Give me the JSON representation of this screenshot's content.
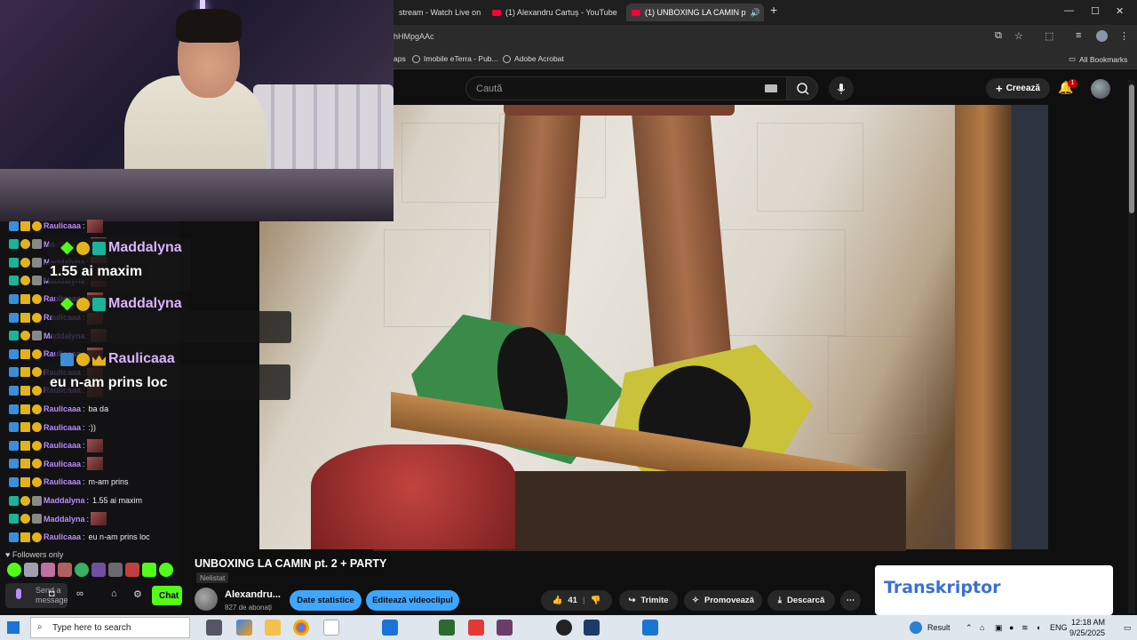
{
  "browser": {
    "tabs": [
      {
        "title": "stream - Watch Live on",
        "active": false
      },
      {
        "title": "(1) Alexandru Cartuș - YouTube",
        "active": false
      },
      {
        "title": "(1) UNBOXING LA CAMIN p",
        "active": true
      }
    ],
    "url_fragment": "hHMpgAAc",
    "bookmarks": [
      "aps",
      "Imobile eTerra - Pub...",
      "Adobe Acrobat"
    ],
    "all_bookmarks": "All Bookmarks"
  },
  "youtube": {
    "search_placeholder": "Caută",
    "create_label": "Creează",
    "notification_count": "1",
    "video_title": "UNBOXING LA CAMIN pt. 2 + PARTY",
    "visibility": "Nelistat",
    "channel_name": "Alexandru...",
    "subscribers": "827 de abonați",
    "buttons": {
      "stats": "Date statistice",
      "edit": "Editează videoclipul",
      "likes": "41",
      "share": "Trimite",
      "promote": "Promovează",
      "download": "Descarcă"
    }
  },
  "chat": {
    "lines": [
      {
        "user": "Raulicaaa",
        "msg": ""
      },
      {
        "user": "Maddalyna",
        "msg": ""
      },
      {
        "user": "Maddalyna",
        "msg": ""
      },
      {
        "user": "Maddalyna",
        "msg": ""
      },
      {
        "user": "Raulicaaa",
        "msg": ""
      },
      {
        "user": "Raulicaaa",
        "msg": ""
      },
      {
        "user": "Maddalyna",
        "msg": ""
      },
      {
        "user": "Raulicaaa",
        "msg": ""
      },
      {
        "user": "Raulicaaa",
        "msg": ""
      },
      {
        "user": "Raulicaaa",
        "msg": ""
      },
      {
        "user": "Raulicaaa",
        "msg": "ba da"
      },
      {
        "user": "Raulicaaa",
        "msg": ":))"
      },
      {
        "user": "Raulicaaa",
        "msg": ""
      },
      {
        "user": "Raulicaaa",
        "msg": ""
      },
      {
        "user": "Raulicaaa",
        "msg": "m-am prins"
      },
      {
        "user": "Maddalyna",
        "msg": "1.55 ai maxim"
      },
      {
        "user": "Maddalyna",
        "msg": ""
      },
      {
        "user": "Raulicaaa",
        "msg": "eu n-am prins loc"
      }
    ],
    "followers_only": "Followers only",
    "input_placeholder": "Send a message",
    "chat_button": "Chat"
  },
  "overlay": {
    "pop1_name": "Maddalyna",
    "pop1_text": "1.55 ai maxim",
    "pop2_name": "Maddalyna",
    "pop3_name": "Raulicaaa",
    "pop3_text": "eu n-am prins loc"
  },
  "ad": {
    "logo": "Transkriptor"
  },
  "taskbar": {
    "search_placeholder": "Type here to search",
    "result_label": "Result",
    "lang": "ENG",
    "time": "12:18 AM",
    "date": "9/25/2025"
  },
  "colors": {
    "kick_green": "#53fc18",
    "yt_blue": "#3ea6ff",
    "username_purple": "#b98cff"
  }
}
